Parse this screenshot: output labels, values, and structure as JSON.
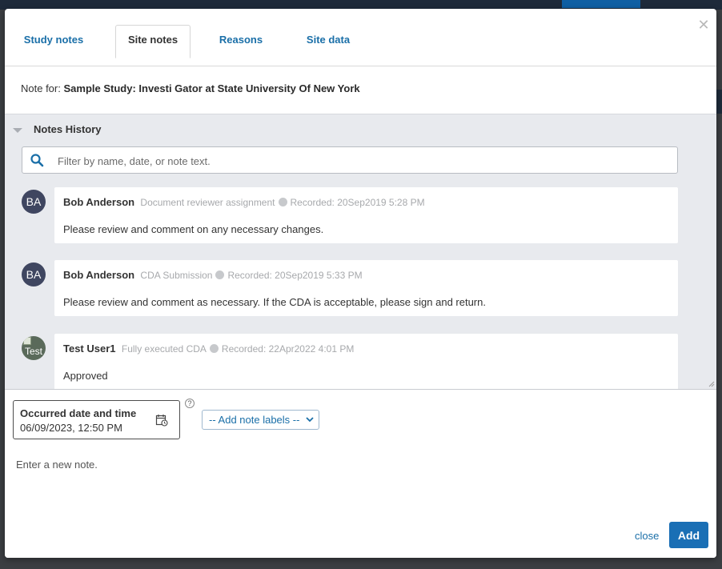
{
  "tabs": [
    {
      "label": "Study notes",
      "active": false
    },
    {
      "label": "Site notes",
      "active": true
    },
    {
      "label": "Reasons",
      "active": false
    },
    {
      "label": "Site data",
      "active": false
    }
  ],
  "note_for": {
    "prefix": "Note for:",
    "value": "Sample Study: Investi Gator at State University Of New York"
  },
  "history": {
    "title": "Notes History",
    "search_placeholder": "Filter by name, date, or note text.",
    "entries": [
      {
        "initials": "BA",
        "author": "Bob Anderson",
        "label": "Document reviewer assignment",
        "recorded": "Recorded: 20Sep2019  5:28 PM",
        "text": "Please review and comment on any necessary changes."
      },
      {
        "initials": "BA",
        "author": "Bob Anderson",
        "label": "CDA Submission",
        "recorded": "Recorded: 20Sep2019  5:33 PM",
        "text": "Please review and comment as necessary. If the CDA is acceptable, please sign and return."
      },
      {
        "initials": "Test",
        "author": "Test User1",
        "label": "Fully executed CDA",
        "recorded": "Recorded: 22Apr2022  4:01 PM",
        "text": "Approved"
      }
    ]
  },
  "compose": {
    "date_label": "Occurred date and time",
    "date_value": "06/09/2023, 12:50 PM",
    "help": "?",
    "labels_placeholder": "-- Add note labels --",
    "note_placeholder": "Enter a new note.",
    "close_label": "close",
    "add_label": "Add"
  },
  "colors": {
    "accent": "#1a6fa8",
    "button": "#1a6fb5",
    "avatar": "#3f4660"
  }
}
